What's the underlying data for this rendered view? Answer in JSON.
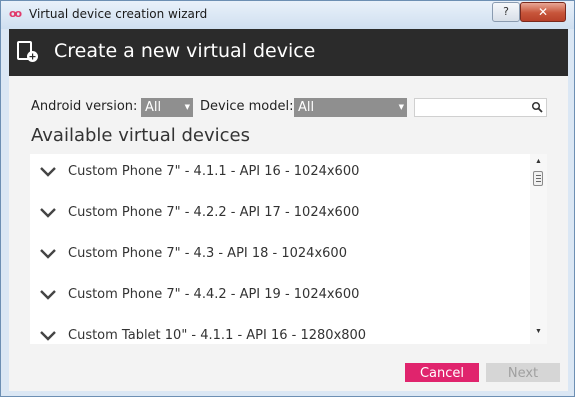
{
  "window": {
    "title": "Virtual device creation wizard",
    "help_label": "?",
    "close_label": "✕"
  },
  "header": {
    "title": "Create a new virtual device"
  },
  "filters": {
    "android_version_label": "Android version:",
    "android_version_value": "All",
    "device_model_label": "Device model:",
    "device_model_value": "All",
    "search_placeholder": ""
  },
  "section_title": "Available virtual devices",
  "devices": [
    {
      "label": "Custom Phone 7\" - 4.1.1 - API 16 - 1024x600"
    },
    {
      "label": "Custom Phone 7\" - 4.2.2 - API 17 - 1024x600"
    },
    {
      "label": "Custom Phone 7\" - 4.3 - API 18 - 1024x600"
    },
    {
      "label": "Custom Phone 7\" - 4.4.2 - API 19 - 1024x600"
    },
    {
      "label": "Custom Tablet 10\" - 4.1.1 - API 16 - 1280x800"
    }
  ],
  "buttons": {
    "cancel": "Cancel",
    "next": "Next"
  },
  "icons": {
    "app": "genymotion-logo-icon",
    "header": "new-device-icon",
    "search": "search-icon",
    "expand": "chevron-down-icon"
  },
  "colors": {
    "accent": "#e0246d",
    "header_bg": "#2b2b2b",
    "select_bg": "#8f8f8f"
  }
}
